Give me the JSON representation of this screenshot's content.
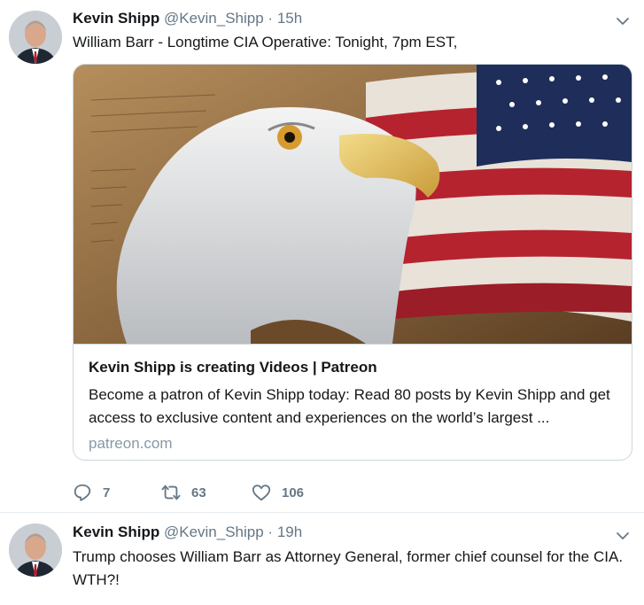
{
  "tweets": [
    {
      "name": "Kevin Shipp",
      "handle": "@Kevin_Shipp",
      "dot": "·",
      "time": "15h",
      "text": "William Barr - Longtime CIA Operative:  Tonight, 7pm EST,",
      "card": {
        "title": "Kevin Shipp is creating Videos | Patreon",
        "description": "Become a patron of Kevin Shipp today: Read 80 posts by Kevin Shipp and get access to exclusive content and experiences on the world’s largest ...",
        "url": "patreon.com",
        "image_text": "We the People"
      },
      "actions": {
        "replies": "7",
        "retweets": "63",
        "likes": "106"
      }
    },
    {
      "name": "Kevin Shipp",
      "handle": "@Kevin_Shipp",
      "dot": "·",
      "time": "19h",
      "text": "Trump chooses William Barr as Attorney General, former chief counsel for the CIA. WTH?!"
    }
  ],
  "icons": {
    "reply": "reply-icon",
    "retweet": "retweet-icon",
    "like": "heart-icon",
    "more": "chevron-down-icon"
  },
  "colors": {
    "text": "#14171a",
    "secondary": "#657786",
    "border": "#e6ecf0",
    "card_border": "#ccd6dd"
  }
}
